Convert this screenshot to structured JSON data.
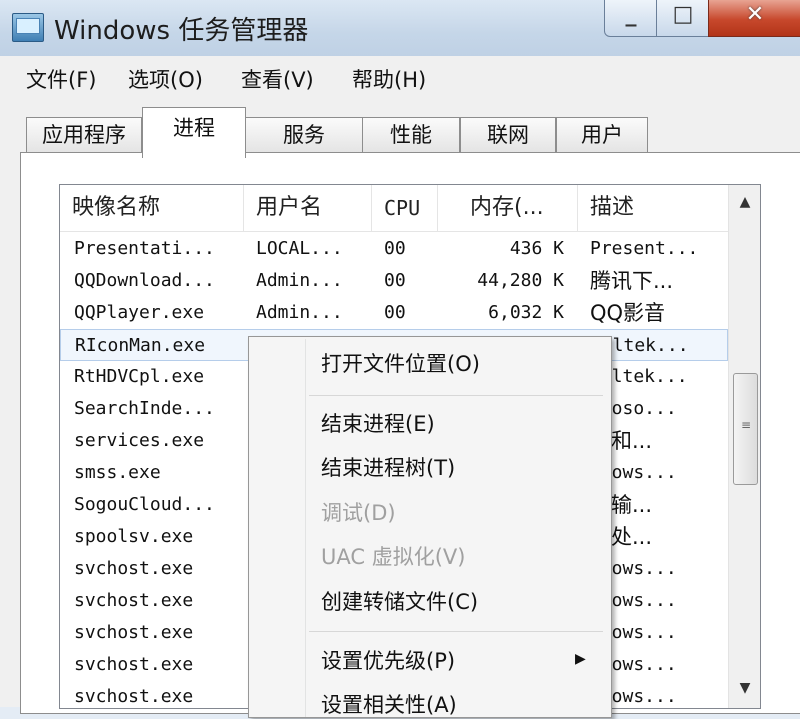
{
  "window": {
    "title": "Windows 任务管理器",
    "min_glyph": "▭",
    "max_glyph": "□",
    "close_glyph": "✕"
  },
  "menubar": [
    "文件(F)",
    "选项(O)",
    "查看(V)",
    "帮助(H)"
  ],
  "tabs": [
    "应用程序",
    "进程",
    "服务",
    "性能",
    "联网",
    "用户"
  ],
  "active_tab": "进程",
  "columns": [
    "映像名称",
    "用户名",
    "CPU",
    "内存(...",
    "描述"
  ],
  "rows": [
    {
      "name": "Presentati...",
      "user": "LOCAL...",
      "cpu": "00",
      "mem": "436 K",
      "desc": "Present..."
    },
    {
      "name": "QQDownload...",
      "user": "Admin...",
      "cpu": "00",
      "mem": "44,280 K",
      "desc": "腾讯下..."
    },
    {
      "name": "QQPlayer.exe",
      "user": "Admin...",
      "cpu": "00",
      "mem": "6,032 K",
      "desc": "QQ影音"
    },
    {
      "name": "RIconMan.exe",
      "user": "",
      "cpu": "",
      "mem": "",
      "desc": "ealtek..."
    },
    {
      "name": "RtHDVCpl.exe",
      "user": "",
      "cpu": "",
      "mem": "",
      "desc": "ealtek..."
    },
    {
      "name": "SearchInde...",
      "user": "",
      "cpu": "",
      "mem": "",
      "desc": "croso..."
    },
    {
      "name": "services.exe",
      "user": "",
      "cpu": "",
      "mem": "",
      "desc": "务和..."
    },
    {
      "name": "smss.exe",
      "user": "",
      "cpu": "",
      "mem": "",
      "desc": "ndows..."
    },
    {
      "name": "SogouCloud...",
      "user": "",
      "cpu": "",
      "mem": "",
      "desc": "狗输..."
    },
    {
      "name": "spoolsv.exe",
      "user": "",
      "cpu": "",
      "mem": "",
      "desc": "台处..."
    },
    {
      "name": "svchost.exe",
      "user": "",
      "cpu": "",
      "mem": "",
      "desc": "ndows..."
    },
    {
      "name": "svchost.exe",
      "user": "",
      "cpu": "",
      "mem": "",
      "desc": "ndows..."
    },
    {
      "name": "svchost.exe",
      "user": "",
      "cpu": "",
      "mem": "",
      "desc": "ndows..."
    },
    {
      "name": "svchost.exe",
      "user": "",
      "cpu": "",
      "mem": "",
      "desc": "ndows..."
    },
    {
      "name": "svchost.exe",
      "user": "",
      "cpu": "",
      "mem": "",
      "desc": "ndows..."
    }
  ],
  "selected_row": 3,
  "context_menu": [
    {
      "label": "打开文件位置(O)",
      "disabled": false
    },
    {
      "label": "结束进程(E)",
      "disabled": false
    },
    {
      "label": "结束进程树(T)",
      "disabled": false
    },
    {
      "label": "调试(D)",
      "disabled": true
    },
    {
      "label": "UAC 虚拟化(V)",
      "disabled": true
    },
    {
      "label": "创建转储文件(C)",
      "disabled": false
    },
    {
      "label": "设置优先级(P)",
      "disabled": false,
      "submenu": true
    },
    {
      "label": "设置相关性(A)",
      "disabled": false
    }
  ],
  "icons": {
    "scroll_up": "▲",
    "scroll_down": "▼",
    "submenu": "▶",
    "grip": "≡",
    "sort": "^"
  }
}
